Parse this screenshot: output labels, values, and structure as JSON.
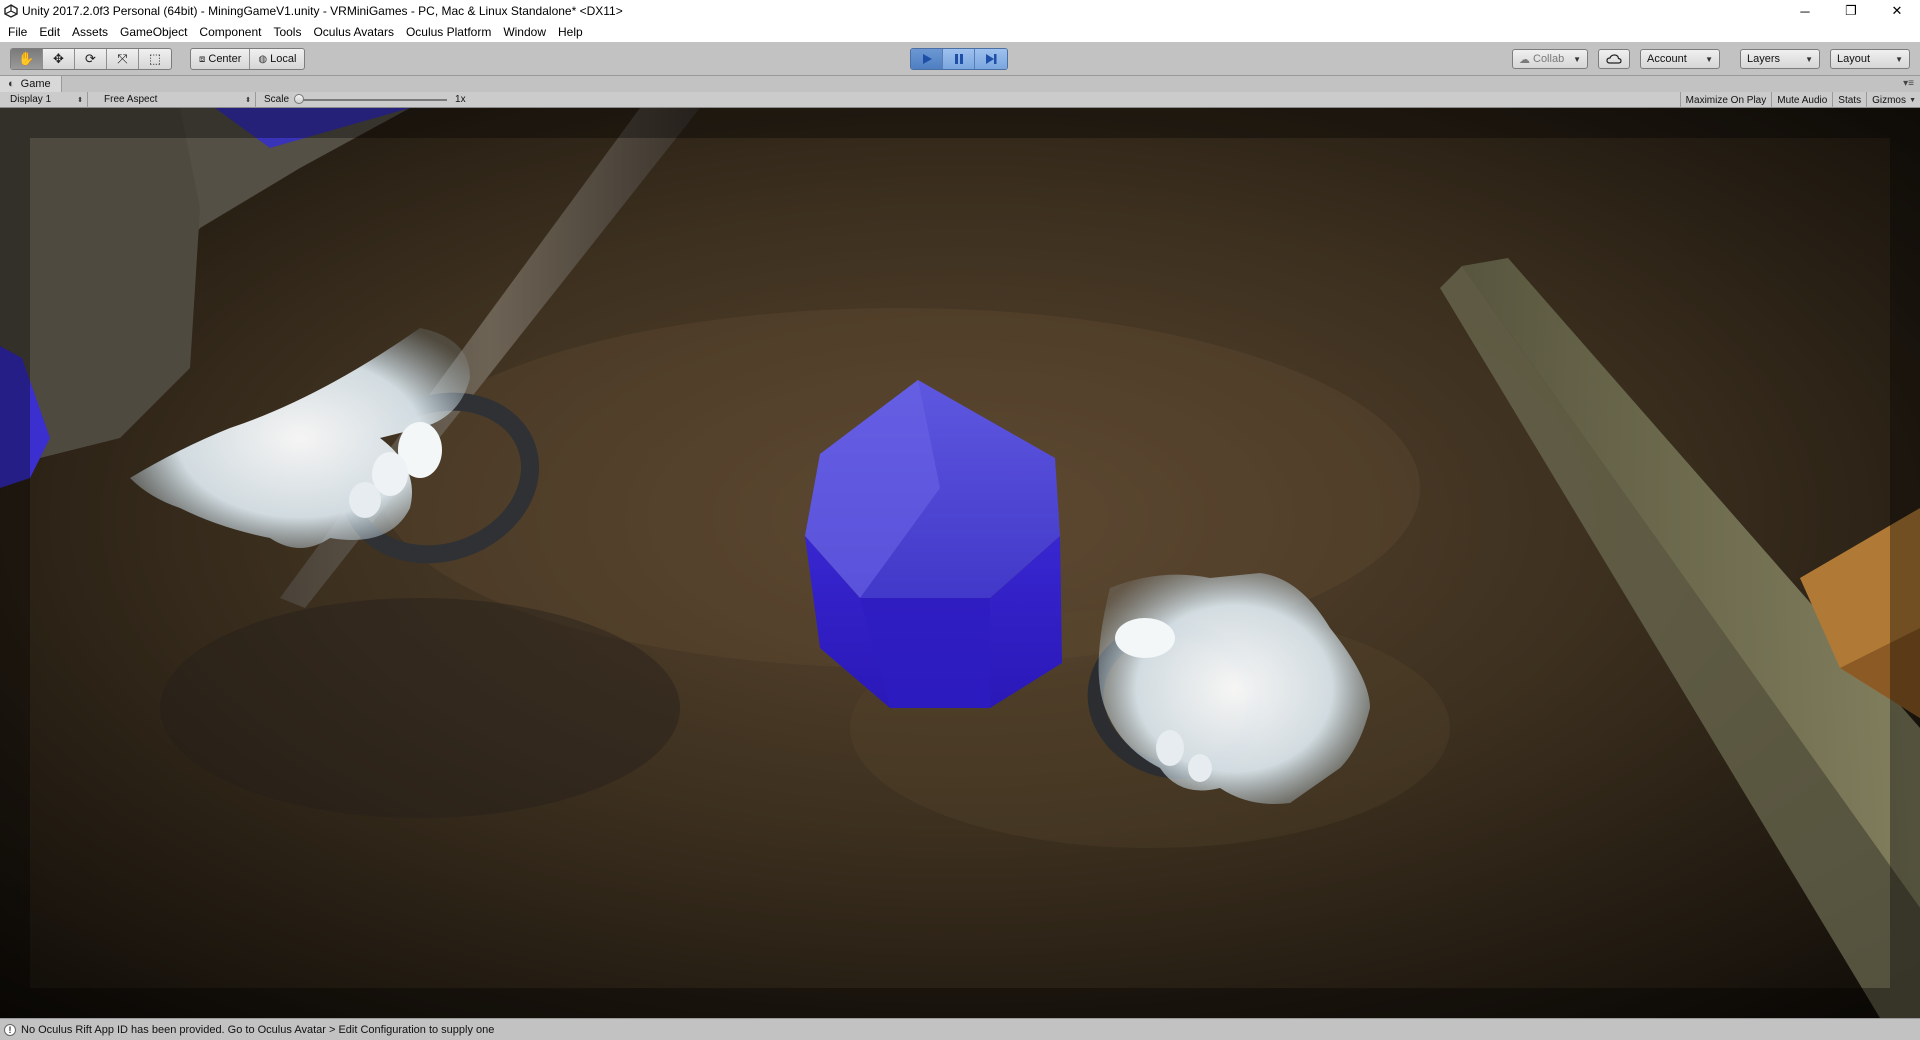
{
  "window": {
    "title": "Unity 2017.2.0f3 Personal (64bit) - MiningGameV1.unity - VRMiniGames - PC, Mac & Linux Standalone* <DX11>",
    "controls": {
      "minimize": "─",
      "restore": "❐",
      "close": "✕"
    }
  },
  "menu": {
    "items": [
      "File",
      "Edit",
      "Assets",
      "GameObject",
      "Component",
      "Tools",
      "Oculus Avatars",
      "Oculus Platform",
      "Window",
      "Help"
    ]
  },
  "toolbar": {
    "transform_tools": [
      {
        "name": "hand-tool",
        "glyph": "✋",
        "active": true
      },
      {
        "name": "move-tool",
        "glyph": "✥",
        "active": false
      },
      {
        "name": "rotate-tool",
        "glyph": "⟳",
        "active": false
      },
      {
        "name": "scale-tool",
        "glyph": "⤧",
        "active": false
      },
      {
        "name": "rect-tool",
        "glyph": "⬚",
        "active": false
      }
    ],
    "pivot_mode": "Center",
    "pivot_rotation": "Local",
    "playing": true,
    "collab": "Collab",
    "account": "Account",
    "layers": "Layers",
    "layout": "Layout"
  },
  "game_panel": {
    "tab_label": "Game",
    "display": "Display 1",
    "aspect": "Free Aspect",
    "scale_label": "Scale",
    "scale_value": "1x",
    "maximize_on_play": "Maximize On Play",
    "mute_audio": "Mute Audio",
    "stats": "Stats",
    "gizmos": "Gizmos"
  },
  "status": {
    "message": "No Oculus Rift App ID has been provided. Go to Oculus Avatar > Edit Configuration to supply one"
  },
  "colors": {
    "chrome": "#c2c2c2",
    "play_active": "#4f7fc2",
    "crystal": "#3a2fd6",
    "ground": "#3a2e1f"
  }
}
